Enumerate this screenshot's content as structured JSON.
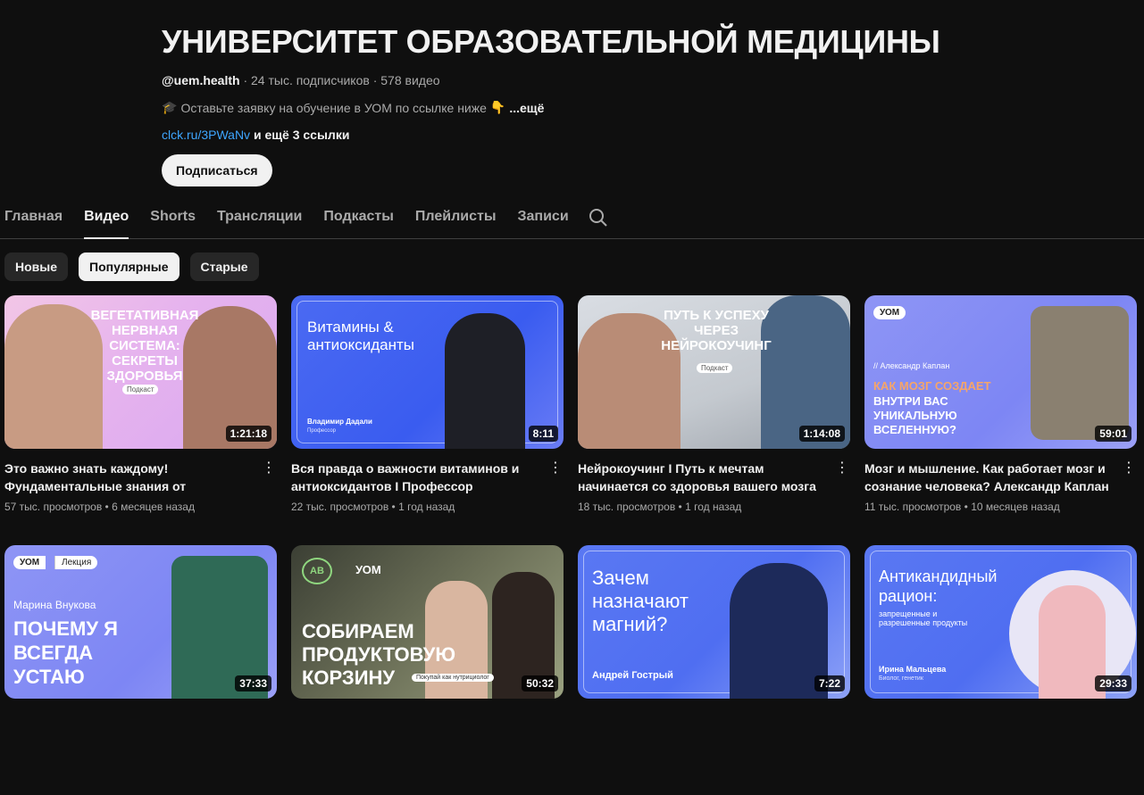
{
  "channel": {
    "title": "УНИВЕРСИТЕТ ОБРАЗОВАТЕЛЬНОЙ МЕДИЦИНЫ",
    "handle": "@uem.health",
    "subscribers": "· 24 тыс. подписчиков",
    "video_count": "· 578 видео",
    "description": "Оставьте заявку на обучение в УОМ по ссылке ниже",
    "description_more": "...ещё",
    "link": "clck.ru/3PWaNv",
    "more_links": "и ещё 3 ссылки",
    "subscribe_label": "Подписаться"
  },
  "tabs": [
    {
      "label": "Главная",
      "active": false
    },
    {
      "label": "Видео",
      "active": true
    },
    {
      "label": "Shorts",
      "active": false
    },
    {
      "label": "Трансляции",
      "active": false
    },
    {
      "label": "Подкасты",
      "active": false
    },
    {
      "label": "Плейлисты",
      "active": false
    },
    {
      "label": "Записи",
      "active": false
    }
  ],
  "chips": [
    {
      "label": "Новые",
      "selected": false
    },
    {
      "label": "Популярные",
      "selected": true
    },
    {
      "label": "Старые",
      "selected": false
    }
  ],
  "videos": [
    {
      "title": "Это важно знать каждому! Фундаментальные знания от профессор...",
      "views": "57 тыс. просмотров",
      "age": "6 месяцев назад",
      "duration": "1:21:18",
      "thumb_text": "ВЕГЕТАТИВНАЯ НЕРВНАЯ СИСТЕМА: СЕКРЕТЫ ЗДОРОВЬЯ",
      "thumb_badge": "Подкаст"
    },
    {
      "title": "Вся правда о важности витаминов и антиоксидантов I Профессор Владимир...",
      "views": "22 тыс. просмотров",
      "age": "1 год назад",
      "duration": "8:11",
      "thumb_text": "Витамины & антиоксиданты",
      "thumb_name": "Владимир Дадали",
      "thumb_role": "Профессор"
    },
    {
      "title": "Нейрокоучинг I Путь к мечтам начинается со здоровья вашего мозга",
      "views": "18 тыс. просмотров",
      "age": "1 год назад",
      "duration": "1:14:08",
      "thumb_text": "ПУТЬ К УСПЕХУ ЧЕРЕЗ НЕЙРОКОУЧИНГ",
      "thumb_badge": "Подкаст"
    },
    {
      "title": "Мозг и мышление. Как работает мозг и сознание человека? Александр Каплан",
      "views": "11 тыс. просмотров",
      "age": "10 месяцев назад",
      "duration": "59:01",
      "thumb_logo": "УОМ",
      "thumb_name": "// Александр Каплан",
      "thumb_text_accent": "КАК МОЗГ СОЗДАЕТ",
      "thumb_text": "ВНУТРИ ВАС УНИКАЛЬНУЮ ВСЕЛЕННУЮ?"
    },
    {
      "duration": "37:33",
      "thumb_logo": "УОМ",
      "thumb_tag": "Лекция",
      "thumb_name": "Марина Внукова",
      "thumb_text": "ПОЧЕМУ Я ВСЕГДА УСТАЮ"
    },
    {
      "duration": "50:32",
      "thumb_logo": "УОМ",
      "thumb_text": "СОБИРАЕМ ПРОДУКТОВУЮ КОРЗИНУ",
      "thumb_badge": "Покупай как нутрициолог"
    },
    {
      "duration": "7:22",
      "thumb_text": "Зачем назначают магний?",
      "thumb_name": "Андрей Гострый"
    },
    {
      "duration": "29:33",
      "thumb_text": "Антикандидный рацион:",
      "thumb_sub": "запрещенные и разрешенные продукты",
      "thumb_name": "Ирина Мальцева",
      "thumb_role": "Биолог, генетик"
    }
  ],
  "colors": {
    "background": "#0f0f0f",
    "link": "#3ea6ff",
    "accent_orange": "#f5a56a"
  }
}
